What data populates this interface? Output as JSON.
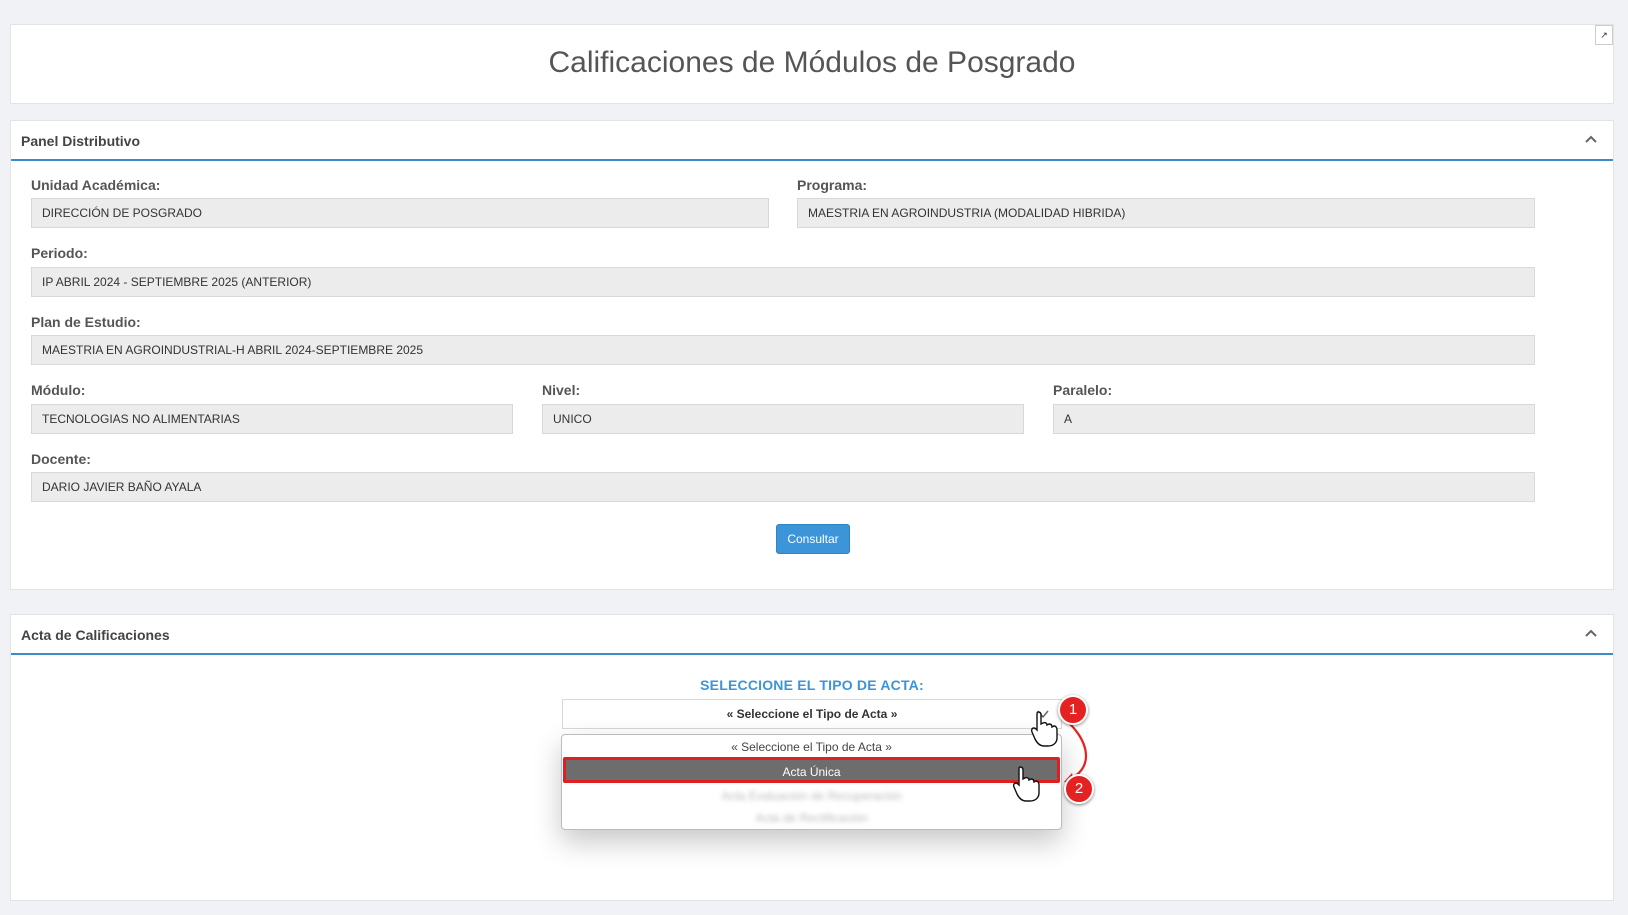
{
  "header": {
    "title": "Calificaciones de Módulos de Posgrado",
    "expand_icon": "↗"
  },
  "panel_distributivo": {
    "title": "Panel Distributivo",
    "fields": {
      "unidad": {
        "label": "Unidad Académica:",
        "value": "DIRECCIÓN DE POSGRADO"
      },
      "programa": {
        "label": "Programa:",
        "value": "MAESTRIA EN AGROINDUSTRIA (MODALIDAD HIBRIDA)"
      },
      "periodo": {
        "label": "Periodo:",
        "value": "IP ABRIL 2024 - SEPTIEMBRE 2025 (ANTERIOR)"
      },
      "plan": {
        "label": "Plan de Estudio:",
        "value": "MAESTRIA EN AGROINDUSTRIAL-H ABRIL 2024-SEPTIEMBRE 2025"
      },
      "modulo": {
        "label": "Módulo:",
        "value": "TECNOLOGIAS NO ALIMENTARIAS"
      },
      "nivel": {
        "label": "Nivel:",
        "value": "UNICO"
      },
      "paralelo": {
        "label": "Paralelo:",
        "value": "A"
      },
      "docente": {
        "label": "Docente:",
        "value": "DARIO JAVIER BAÑO AYALA"
      }
    },
    "consultar_label": "Consultar"
  },
  "acta": {
    "title": "Acta de Calificaciones",
    "select_heading": "SELECCIONE EL TIPO DE ACTA:",
    "select_value": "« Seleccione el Tipo de Acta »",
    "options": {
      "placeholder": "« Seleccione el Tipo de Acta »",
      "selected": "Acta Única",
      "blurred_1": "Acta Evaluación de Recuperación",
      "blurred_2": "Acta de Rectificación"
    }
  },
  "annotations": {
    "step1": "1",
    "step2": "2",
    "accent_color": "#e52222"
  },
  "colors": {
    "primary": "#3b95d8",
    "panel_border": "#3a8ccf",
    "input_bg": "#ececec"
  }
}
